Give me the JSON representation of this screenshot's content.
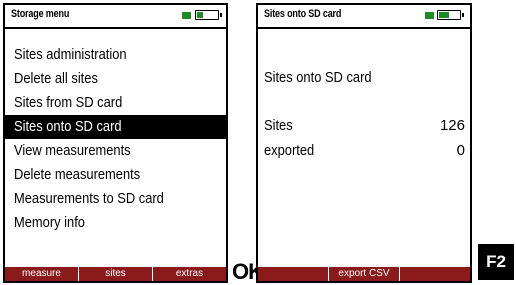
{
  "left_screen": {
    "title": "Storage menu",
    "battery_level": 0.3,
    "menu_items": [
      {
        "label": "Sites administration",
        "selected": false
      },
      {
        "label": "Delete all sites",
        "selected": false
      },
      {
        "label": "Sites from SD card",
        "selected": false
      },
      {
        "label": "Sites onto SD card",
        "selected": true
      },
      {
        "label": "View measurements",
        "selected": false
      },
      {
        "label": "Delete measurements",
        "selected": false
      },
      {
        "label": "Measurements to SD card",
        "selected": false
      },
      {
        "label": "Memory info",
        "selected": false
      }
    ],
    "softkeys": [
      "measure",
      "sites",
      "extras"
    ]
  },
  "ok_key": "OK",
  "right_screen": {
    "title": "Sites onto SD card",
    "battery_level": 0.5,
    "heading": "Sites onto SD card",
    "rows": [
      {
        "label": "Sites",
        "value": "126"
      },
      {
        "label": "exported",
        "value": "0"
      }
    ],
    "softkeys": [
      "",
      "export CSV",
      ""
    ]
  },
  "f2_key": "F2",
  "colors": {
    "softkey_bar": "#8b1a1a",
    "battery_green": "#1f8a2a",
    "selection_bg": "#000000"
  }
}
